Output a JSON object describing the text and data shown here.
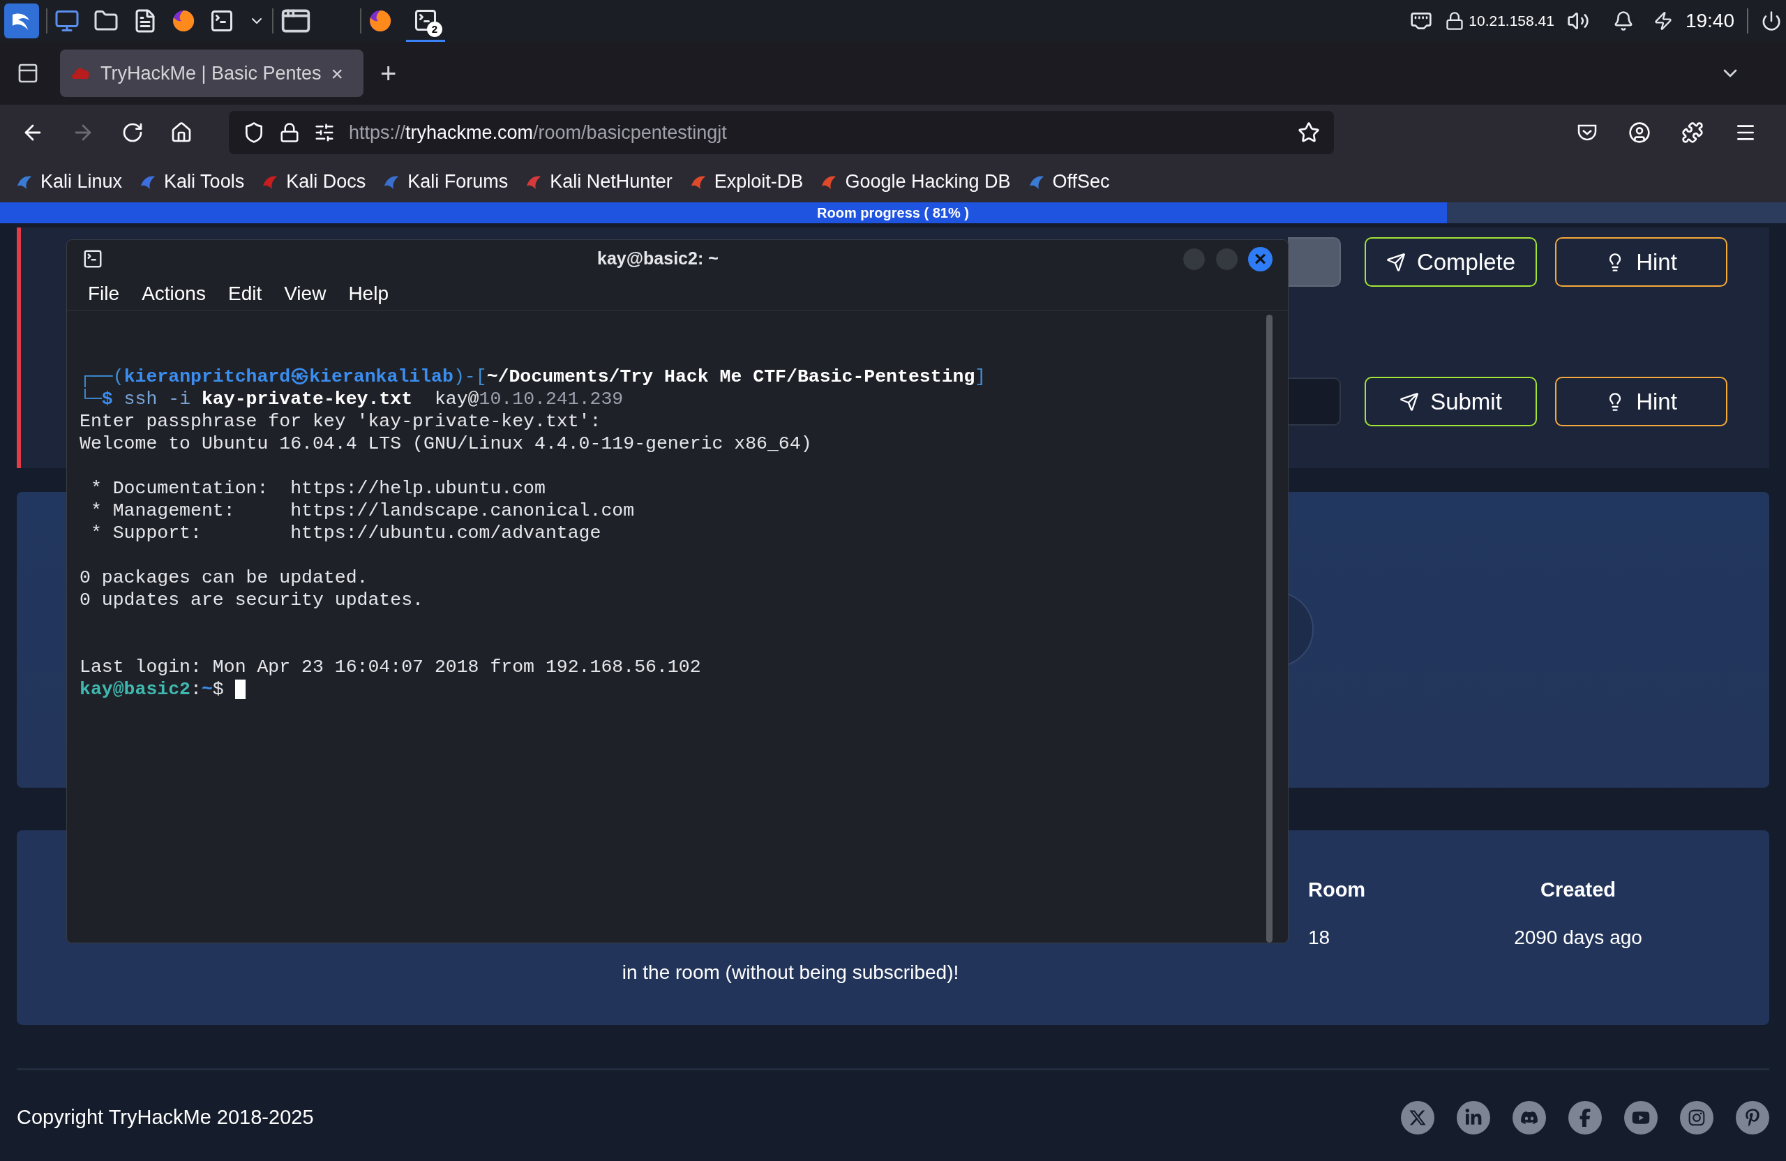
{
  "taskbar": {
    "badge": "2",
    "ip": "10.21.158.41",
    "time": "19:40"
  },
  "browser": {
    "tab": {
      "title": "TryHackMe | Basic Pentes",
      "close": "×"
    },
    "new_tab": "+",
    "forward_disabled": true,
    "url": {
      "scheme": "https://",
      "host": "tryhackme.com",
      "path": "/room/basicpentestingjt"
    },
    "bookmarks": [
      "Kali Linux",
      "Kali Tools",
      "Kali Docs",
      "Kali Forums",
      "Kali NetHunter",
      "Exploit-DB",
      "Google Hacking DB",
      "OffSec"
    ]
  },
  "progress": {
    "label": "Room progress ( 81% )",
    "level": 0.81
  },
  "questions": [
    {
      "kind": "completed",
      "buttons": [
        {
          "kind": "complete",
          "label": "Complete"
        },
        {
          "kind": "hint",
          "label": "Hint"
        }
      ]
    },
    {
      "kind": "open",
      "buttons": [
        {
          "kind": "submit",
          "label": "Submit"
        },
        {
          "kind": "hint",
          "label": "Hint"
        }
      ]
    }
  ],
  "room_info": [
    {
      "kind": "continuation",
      "value": "in the room (without being subscribed)!"
    },
    {
      "kind": "tail",
      "heading": "Room",
      "value": "18"
    },
    {
      "kind": "full",
      "heading": "Created",
      "value": "2090 days ago"
    }
  ],
  "footer": {
    "copyright": "Copyright TryHackMe 2018-2025"
  },
  "terminal": {
    "title": "kay@basic2: ~",
    "close": "×",
    "menu": [
      "File",
      "Actions",
      "Edit",
      "View",
      "Help"
    ],
    "lines": [
      {
        "kind": "text",
        "segments": [
          {
            "text": "┌──(",
            "kind": "frame"
          },
          {
            "text": "kieranpritchard㉿kierankalilab",
            "kind": "user"
          },
          {
            "text": ")-[",
            "kind": "frame"
          },
          {
            "text": "~/Documents/Try Hack Me CTF/Basic-Pentesting",
            "kind": "path"
          },
          {
            "text": "]",
            "kind": "frame"
          }
        ]
      },
      {
        "kind": "text",
        "segments": [
          {
            "text": "└─",
            "kind": "frame"
          },
          {
            "text": "$",
            "kind": "symbol"
          },
          {
            "text": " ssh -i ",
            "kind": "cmd"
          },
          {
            "text": "kay-private-key.txt",
            "kind": "bold"
          },
          {
            "text": "  kay@",
            "kind": "plain"
          },
          {
            "text": "10.10.241.239",
            "kind": "dim"
          }
        ]
      },
      {
        "kind": "text",
        "segments": [
          {
            "text": "Enter passphrase for key 'kay-private-key.txt':",
            "kind": "plain"
          }
        ]
      },
      {
        "kind": "text",
        "segments": [
          {
            "text": "Welcome to Ubuntu 16.04.4 LTS (GNU/Linux 4.4.0-119-generic x86_64)",
            "kind": "plain"
          }
        ]
      },
      {
        "kind": "blank"
      },
      {
        "kind": "text",
        "segments": [
          {
            "text": " * Documentation:  https://help.ubuntu.com",
            "kind": "plain"
          }
        ]
      },
      {
        "kind": "text",
        "segments": [
          {
            "text": " * Management:     https://landscape.canonical.com",
            "kind": "plain"
          }
        ]
      },
      {
        "kind": "text",
        "segments": [
          {
            "text": " * Support:        https://ubuntu.com/advantage",
            "kind": "plain"
          }
        ]
      },
      {
        "kind": "blank"
      },
      {
        "kind": "text",
        "segments": [
          {
            "text": "0 packages can be updated.",
            "kind": "plain"
          }
        ]
      },
      {
        "kind": "text",
        "segments": [
          {
            "text": "0 updates are security updates.",
            "kind": "plain"
          }
        ]
      },
      {
        "kind": "blank"
      },
      {
        "kind": "blank"
      },
      {
        "kind": "text",
        "segments": [
          {
            "text": "Last login: Mon Apr 23 16:04:07 2018 from 192.168.56.102",
            "kind": "plain"
          }
        ]
      },
      {
        "kind": "prompt",
        "segments": [
          {
            "text": "kay@basic2",
            "kind": "host"
          },
          {
            "text": ":",
            "kind": "plain"
          },
          {
            "text": "~",
            "kind": "tilde"
          },
          {
            "text": "$ ",
            "kind": "plain"
          }
        ]
      }
    ]
  }
}
